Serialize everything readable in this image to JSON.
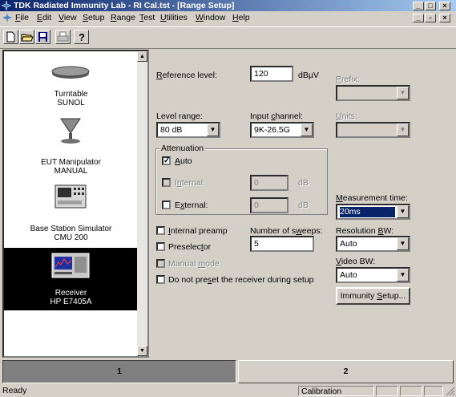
{
  "window": {
    "title": "TDK Radiated Immunity Lab - RI Cal.tst - [Range Setup]"
  },
  "menu": {
    "items": [
      {
        "underline": "F",
        "rest": "ile"
      },
      {
        "underline": "E",
        "rest": "dit"
      },
      {
        "underline": "V",
        "rest": "iew"
      },
      {
        "underline": "S",
        "rest": "etup"
      },
      {
        "underline": "R",
        "rest": "ange"
      },
      {
        "underline": "T",
        "rest": "est"
      },
      {
        "underline": "U",
        "rest": "tilities"
      },
      {
        "underline": "W",
        "rest": "indow"
      },
      {
        "underline": "H",
        "rest": "elp"
      }
    ]
  },
  "sidebar": {
    "items": [
      {
        "line1": "Turntable",
        "line2": "SUNOL",
        "icon": "turntable-icon"
      },
      {
        "line1": "EUT Manipulator",
        "line2": "MANUAL",
        "icon": "antenna-icon"
      },
      {
        "line1": "Base Station Simulator",
        "line2": "CMU 200",
        "icon": "base-station-icon"
      },
      {
        "line1": "Receiver",
        "line2": "HP E7405A",
        "icon": "receiver-icon",
        "selected": true
      }
    ]
  },
  "form": {
    "reference_level": {
      "pre": "",
      "u": "R",
      "post": "eference level:",
      "value": "120",
      "unit": "dBµV"
    },
    "prefix": {
      "u": "P",
      "post": "refix:",
      "value": ""
    },
    "units": {
      "u": "U",
      "post": "nits:",
      "value": ""
    },
    "level_range": {
      "label": "Level range:",
      "value": "80 dB"
    },
    "input_channel": {
      "pre": "Input ",
      "u": "c",
      "post": "hannel:",
      "value": "9K-26.5G"
    },
    "attenuation": {
      "title": "Attenuation",
      "auto": {
        "u": "A",
        "post": "uto",
        "checked": true
      },
      "internal": {
        "pre": "I",
        "u": "n",
        "post": "ternal:",
        "value": "0",
        "unit": "dB"
      },
      "external": {
        "pre": "E",
        "u": "x",
        "post": "ternal:",
        "value": "0",
        "unit": "dB"
      }
    },
    "measurement_time": {
      "u": "M",
      "post": "easurement time:",
      "value": "20ms"
    },
    "internal_preamp": {
      "u": "I",
      "post": "nternal preamp",
      "checked": false
    },
    "number_of_sweeps": {
      "pre": "Number of s",
      "u": "w",
      "post": "eeps:",
      "value": "5"
    },
    "resolution_bw": {
      "pre": "Resolution ",
      "u": "B",
      "post": "W:",
      "value": "Auto"
    },
    "preselector": {
      "pre": "Preselec",
      "u": "t",
      "post": "or",
      "checked": false
    },
    "video_bw": {
      "u": "V",
      "post": "ideo BW:",
      "value": "Auto"
    },
    "manual_mode": {
      "pre": "Manual ",
      "u": "m",
      "post": "ode",
      "checked": false
    },
    "do_not_preset": {
      "pre": "Do not pre",
      "u": "s",
      "post": "et the receiver during setup",
      "checked": false
    },
    "immunity_setup": {
      "pre": "Immunity ",
      "u": "S",
      "post": "etup..."
    }
  },
  "tabs": [
    {
      "label": "1",
      "active": true
    },
    {
      "label": "2",
      "active": false
    }
  ],
  "status": {
    "left": "Ready",
    "mode": "Calibration"
  },
  "colors": {
    "titlebar_start": "#0a246a",
    "titlebar_end": "#a6caf0",
    "selection": "#0a246a",
    "face": "#d4d0c8"
  }
}
